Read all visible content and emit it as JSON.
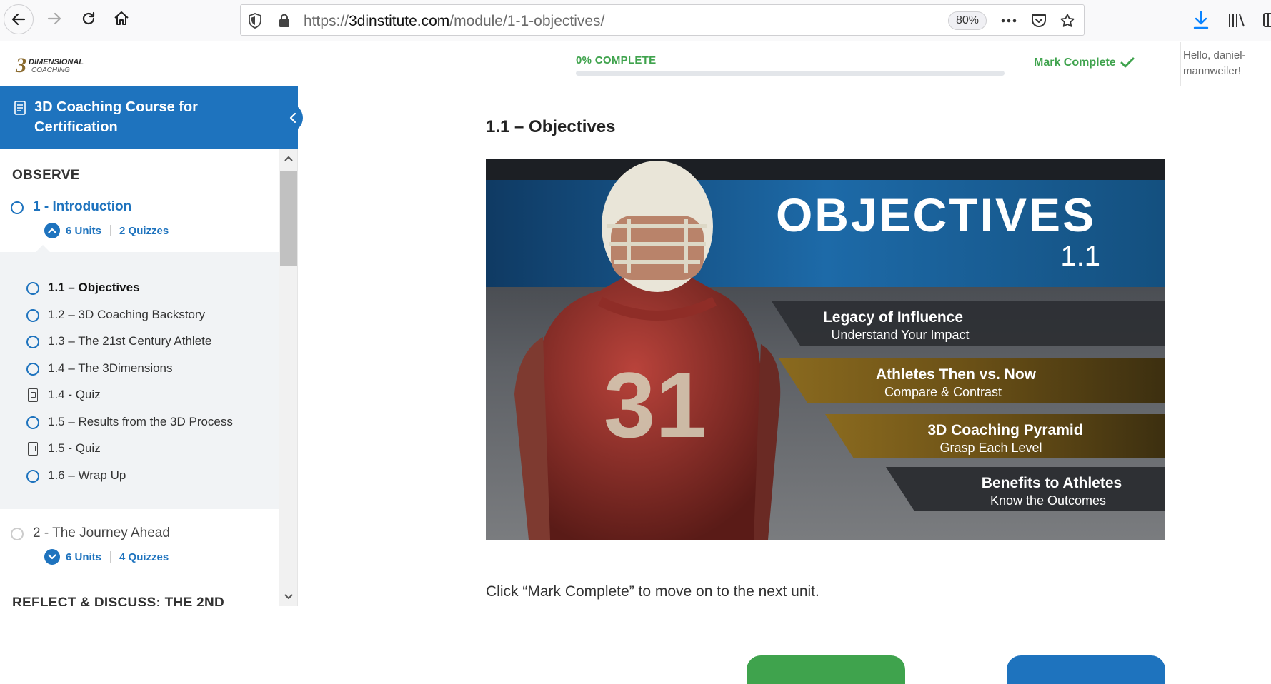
{
  "browser": {
    "url_prefix": "https://",
    "url_domain": "3dinstitute.com",
    "url_path": "/module/1-1-objectives/",
    "zoom": "80%"
  },
  "header": {
    "progress_label": "0% COMPLETE",
    "progress_fraction": 0,
    "mark_complete_label": "Mark Complete",
    "greeting": "Hello, daniel-mannweiler!"
  },
  "sidebar": {
    "course_title": "3D Coaching Course for Certification",
    "sections": [
      {
        "heading": "OBSERVE",
        "lessons": [
          {
            "title": "1 - Introduction",
            "units": "6 Units",
            "quizzes": "2 Quizzes",
            "items": [
              {
                "label": "1.1 – Objectives",
                "type": "unit"
              },
              {
                "label": "1.2 – 3D Coaching Backstory",
                "type": "unit"
              },
              {
                "label": "1.3 – The 21st Century Athlete",
                "type": "unit"
              },
              {
                "label": "1.4 – The 3Dimensions",
                "type": "unit"
              },
              {
                "label": "1.4 - Quiz",
                "type": "quiz"
              },
              {
                "label": "1.5 – Results from the 3D Process",
                "type": "unit"
              },
              {
                "label": "1.5 - Quiz",
                "type": "quiz"
              },
              {
                "label": "1.6 – Wrap Up",
                "type": "unit"
              }
            ]
          },
          {
            "title": "2 - The Journey Ahead",
            "units": "6 Units",
            "quizzes": "4 Quizzes"
          }
        ]
      },
      {
        "heading": "REFLECT & DISCUSS: THE 2ND"
      }
    ]
  },
  "main": {
    "title": "1.1 – Objectives",
    "hero": {
      "heading": "OBJECTIVES",
      "number": "1.1",
      "jersey": "31",
      "bands": [
        {
          "title": "Legacy of Influence",
          "sub": "Understand Your Impact"
        },
        {
          "title": "Athletes Then vs. Now",
          "sub": "Compare & Contrast"
        },
        {
          "title": "3D Coaching Pyramid",
          "sub": "Grasp Each Level"
        },
        {
          "title": "Benefits to Athletes",
          "sub": "Know the Outcomes"
        }
      ]
    },
    "instruction": "Click “Mark Complete” to move on to the next unit."
  },
  "colors": {
    "brand_blue": "#1e73be",
    "complete_green": "#3fa34d"
  }
}
